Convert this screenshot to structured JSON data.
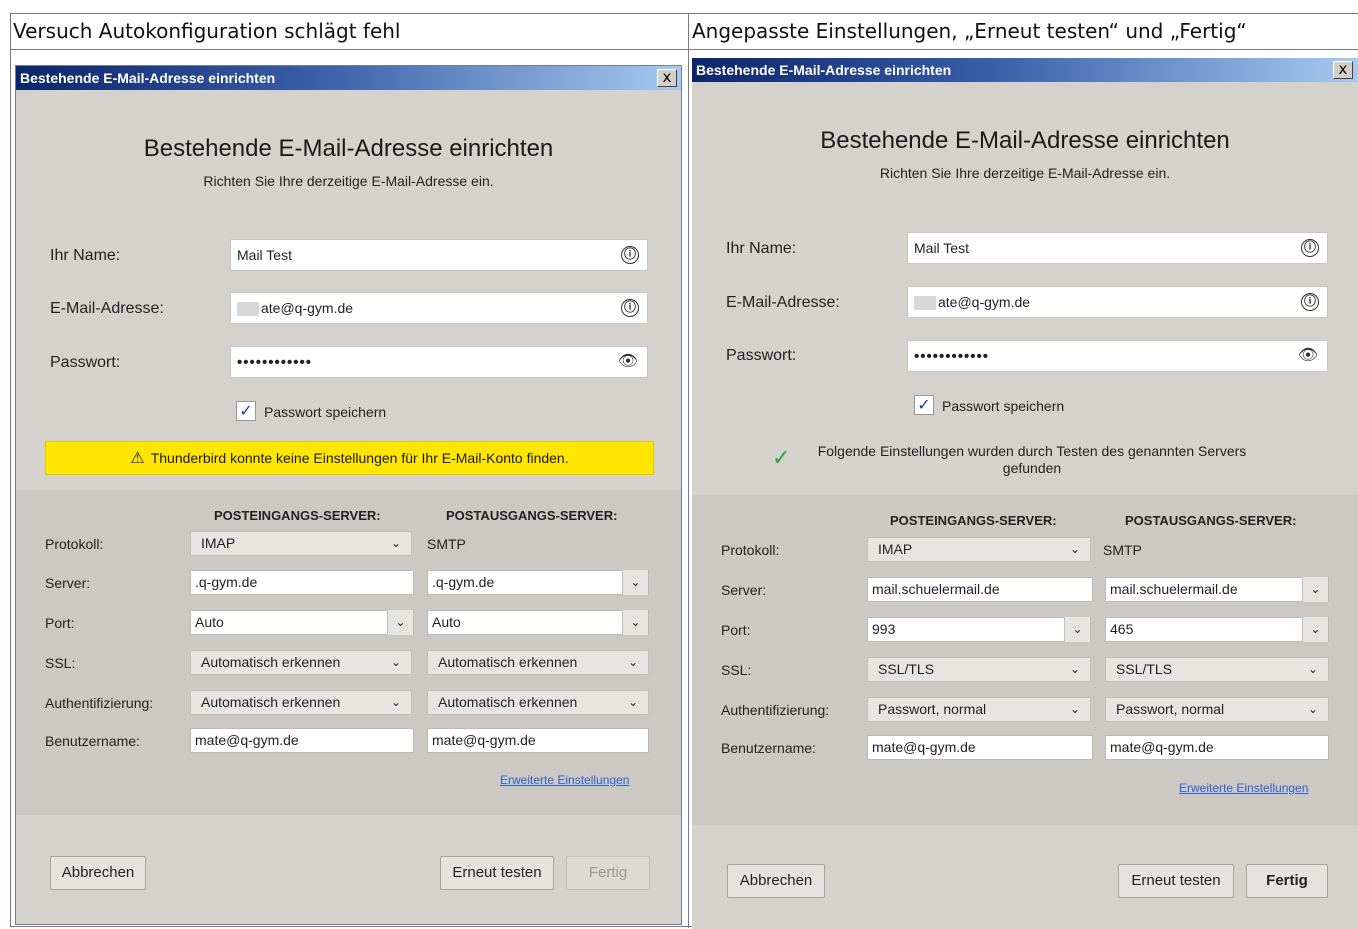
{
  "columns": {
    "left": "Versuch Autokonfiguration schlägt fehl",
    "right": "Angepasste Einstellungen, „Erneut testen“ und „Fertig“"
  },
  "dialog_left": {
    "title": "Bestehende E-Mail-Adresse einrichten",
    "close": "x",
    "heading": "Bestehende E-Mail-Adresse einrichten",
    "subheading": "Richten Sie Ihre derzeitige E-Mail-Adresse ein.",
    "name_label": "Ihr Name:",
    "name_value": "Mail Test",
    "email_label": "E-Mail-Adresse:",
    "email_value": "ate@q-gym.de",
    "password_label": "Passwort:",
    "password_value": "••••••••••••",
    "save_password_label": "Passwort speichern",
    "warning": "Thunderbird konnte keine Einstellungen für Ihr E-Mail-Konto finden.",
    "incoming_header": "POSTEINGANGS-SERVER:",
    "outgoing_header": "POSTAUSGANGS-SERVER:",
    "row_labels": {
      "protocol": "Protokoll:",
      "server": "Server:",
      "port": "Port:",
      "ssl": "SSL:",
      "auth": "Authentifizierung:",
      "username": "Benutzername:"
    },
    "incoming": {
      "protocol": "IMAP",
      "server": ".q-gym.de",
      "port": "Auto",
      "ssl": "Automatisch erkennen",
      "auth": "Automatisch erkennen",
      "username": "mate@q-gym.de"
    },
    "outgoing": {
      "protocol": "SMTP",
      "server": ".q-gym.de",
      "port": "Auto",
      "ssl": "Automatisch erkennen",
      "auth": "Automatisch erkennen",
      "username": "mate@q-gym.de"
    },
    "advanced_link": "Erweiterte Einstellungen",
    "cancel": "Abbrechen",
    "retest": "Erneut testen",
    "done": "Fertig"
  },
  "dialog_right": {
    "title": "Bestehende E-Mail-Adresse einrichten",
    "close": "x",
    "heading": "Bestehende E-Mail-Adresse einrichten",
    "subheading": "Richten Sie Ihre derzeitige E-Mail-Adresse ein.",
    "name_label": "Ihr Name:",
    "name_value": "Mail Test",
    "email_label": "E-Mail-Adresse:",
    "email_value": "ate@q-gym.de",
    "password_label": "Passwort:",
    "password_value": "••••••••••••",
    "save_password_label": "Passwort speichern",
    "success_line1": "Folgende Einstellungen wurden durch Testen des genannten Servers",
    "success_line2": "gefunden",
    "incoming_header": "POSTEINGANGS-SERVER:",
    "outgoing_header": "POSTAUSGANGS-SERVER:",
    "row_labels": {
      "protocol": "Protokoll:",
      "server": "Server:",
      "port": "Port:",
      "ssl": "SSL:",
      "auth": "Authentifizierung:",
      "username": "Benutzername:"
    },
    "incoming": {
      "protocol": "IMAP",
      "server": "mail.schuelermail.de",
      "port": "993",
      "ssl": "SSL/TLS",
      "auth": "Passwort, normal",
      "username": "mate@q-gym.de"
    },
    "outgoing": {
      "protocol": "SMTP",
      "server": "mail.schuelermail.de",
      "port": "465",
      "ssl": "SSL/TLS",
      "auth": "Passwort, normal",
      "username": "mate@q-gym.de"
    },
    "advanced_link": "Erweiterte Einstellungen",
    "cancel": "Abbrechen",
    "retest": "Erneut testen",
    "done": "Fertig"
  },
  "icons": {
    "info": "ⓘ",
    "eye": "👁",
    "check": "✓",
    "warning": "⚠",
    "chevron": "❯",
    "success_check": "✓"
  }
}
